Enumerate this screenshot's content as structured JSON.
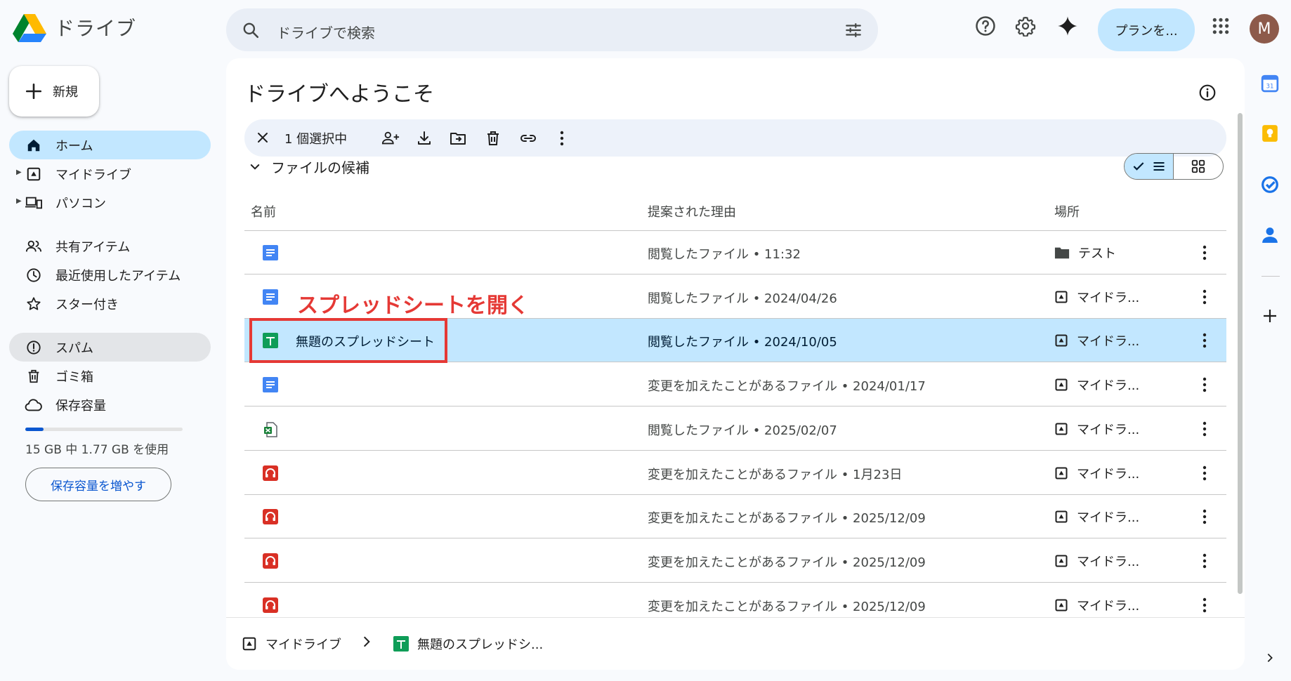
{
  "app": {
    "title": "ドライブ"
  },
  "search": {
    "placeholder": "ドライブで検索"
  },
  "header": {
    "plan_label": "プランを...",
    "avatar_initial": "M"
  },
  "sidebar": {
    "new_label": "新規",
    "items": [
      {
        "label": "ホーム",
        "icon": "home-icon"
      },
      {
        "label": "マイドライブ",
        "icon": "my-drive-icon"
      },
      {
        "label": "パソコン",
        "icon": "computers-icon"
      },
      {
        "label": "共有アイテム",
        "icon": "shared-icon"
      },
      {
        "label": "最近使用したアイテム",
        "icon": "clock-icon"
      },
      {
        "label": "スター付き",
        "icon": "star-icon"
      },
      {
        "label": "スパム",
        "icon": "spam-icon"
      },
      {
        "label": "ゴミ箱",
        "icon": "trash-icon"
      },
      {
        "label": "保存容量",
        "icon": "cloud-icon"
      }
    ],
    "storage_used_fraction": 0.118,
    "storage_text": "15 GB 中 1.77 GB を使用",
    "more_storage_label": "保存容量を増やす"
  },
  "main": {
    "welcome": "ドライブへようこそ",
    "selection_count": "1 個選択中",
    "suggested_label": "ファイルの候補",
    "columns": {
      "name": "名前",
      "reason": "提案された理由",
      "location": "場所"
    },
    "rows": [
      {
        "type": "doc",
        "name": "",
        "reason": "閲覧したファイル • 11:32",
        "location": "テスト",
        "loc_icon": "folder"
      },
      {
        "type": "doc",
        "name": "",
        "reason": "閲覧したファイル • 2024/04/26",
        "location": "マイドラ...",
        "loc_icon": "drive"
      },
      {
        "type": "sheet",
        "name": "無題のスプレッドシート",
        "reason": "閲覧したファイル • 2024/10/05",
        "location": "マイドラ...",
        "loc_icon": "drive",
        "selected": true
      },
      {
        "type": "doc",
        "name": "",
        "reason": "変更を加えたことがあるファイル • 2024/01/17",
        "location": "マイドラ...",
        "loc_icon": "drive"
      },
      {
        "type": "excel",
        "name": "",
        "reason": "閲覧したファイル • 2025/02/07",
        "location": "マイドラ...",
        "loc_icon": "drive"
      },
      {
        "type": "audio",
        "name": "",
        "reason": "変更を加えたことがあるファイル • 1月23日",
        "location": "マイドラ...",
        "loc_icon": "drive"
      },
      {
        "type": "audio",
        "name": "",
        "reason": "変更を加えたことがあるファイル • 2025/12/09",
        "location": "マイドラ...",
        "loc_icon": "drive"
      },
      {
        "type": "audio",
        "name": "",
        "reason": "変更を加えたことがあるファイル • 2025/12/09",
        "location": "マイドラ...",
        "loc_icon": "drive"
      },
      {
        "type": "audio",
        "name": "",
        "reason": "変更を加えたことがあるファイル • 2025/12/09",
        "location": "マイドラ...",
        "loc_icon": "drive"
      }
    ],
    "footer_crumbs": {
      "root": "マイドライブ",
      "file": "無題のスプレッドシ..."
    }
  },
  "annotation": {
    "text": "スプレッドシートを開く",
    "color": "#e53935"
  },
  "colors": {
    "accent": "#0b57d0",
    "selected_bg": "#c2e7ff",
    "doc_blue": "#4285f4",
    "sheet_green": "#0f9d58",
    "audio_red": "#d93025"
  }
}
